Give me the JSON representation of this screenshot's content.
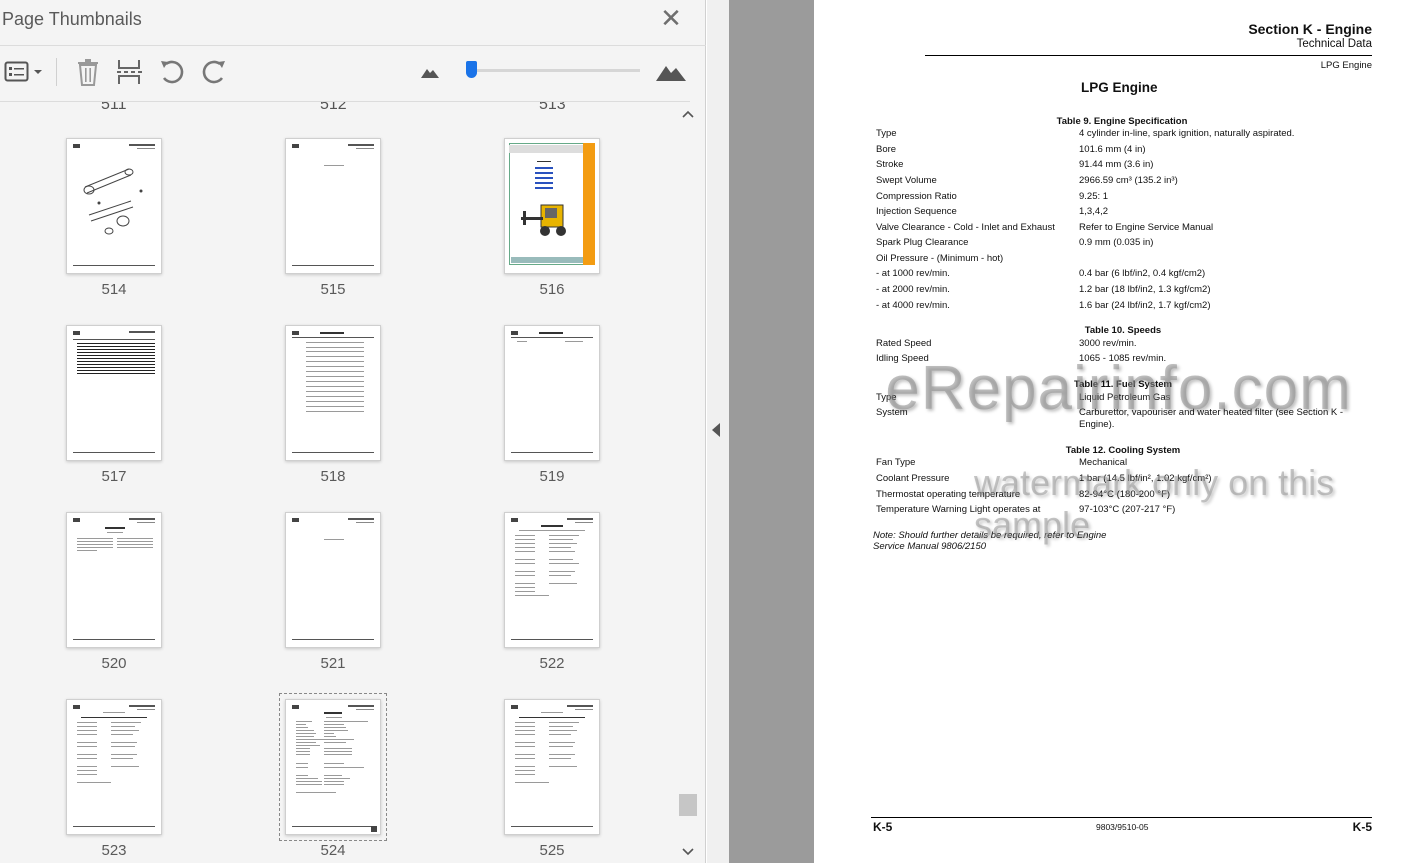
{
  "panel": {
    "title": "Page Thumbnails",
    "close_glyph": "✕",
    "toolbar": {
      "options_icon": "list-options-icon",
      "delete_icon": "trash-icon",
      "extract_icon": "extract-pages-icon",
      "undo_icon": "rotate-ccw-icon",
      "redo_icon": "rotate-cw-icon",
      "zoom_out_icon": "small-mountain-icon",
      "zoom_in_icon": "large-mountain-icon",
      "zoom_level": 0.02
    },
    "cut_labels": [
      "511",
      "512",
      "513"
    ],
    "thumbnails": [
      {
        "label": "514",
        "selected": false
      },
      {
        "label": "515",
        "selected": false
      },
      {
        "label": "516",
        "selected": false
      },
      {
        "label": "517",
        "selected": false
      },
      {
        "label": "518",
        "selected": false
      },
      {
        "label": "519",
        "selected": false
      },
      {
        "label": "520",
        "selected": false
      },
      {
        "label": "521",
        "selected": false
      },
      {
        "label": "522",
        "selected": false
      },
      {
        "label": "523",
        "selected": false
      },
      {
        "label": "524",
        "selected": true
      },
      {
        "label": "525",
        "selected": false
      }
    ]
  },
  "document": {
    "header_section": "Section K - Engine",
    "header_sub": "Technical Data",
    "header_topic": "LPG Engine",
    "page_title": "LPG Engine",
    "tables": [
      {
        "title": "Table 9. Engine Specification",
        "rows": [
          {
            "label": "Type",
            "value": "4 cylinder in-line, spark ignition, naturally aspirated."
          },
          {
            "label": "Bore",
            "value": "101.6 mm (4 in)"
          },
          {
            "label": "Stroke",
            "value": "91.44 mm (3.6 in)"
          },
          {
            "label": "Swept Volume",
            "value": "2966.59 cm³ (135.2 in³)"
          },
          {
            "label": "Compression Ratio",
            "value": "9.25: 1"
          },
          {
            "label": "Injection Sequence",
            "value": "1,3,4,2"
          },
          {
            "label": "Valve Clearance - Cold - Inlet and Exhaust",
            "value": "Refer to Engine Service Manual"
          },
          {
            "label": "Spark Plug Clearance",
            "value": "0.9 mm (0.035 in)"
          },
          {
            "label": "Oil Pressure - (Minimum - hot)",
            "value": ""
          },
          {
            "label": "- at 1000 rev/min.",
            "value": "0.4 bar (6 lbf/in2, 0.4 kgf/cm2)"
          },
          {
            "label": "- at 2000 rev/min.",
            "value": "1.2 bar (18 lbf/in2, 1.3 kgf/cm2)"
          },
          {
            "label": "- at 4000 rev/min.",
            "value": "1.6 bar (24 lbf/in2, 1.7 kgf/cm2)"
          }
        ]
      },
      {
        "title": "Table 10. Speeds",
        "rows": [
          {
            "label": "Rated Speed",
            "value": "3000 rev/min."
          },
          {
            "label": "Idling Speed",
            "value": "1065 - 1085 rev/min."
          }
        ]
      },
      {
        "title": "Table 11. Fuel System",
        "rows": [
          {
            "label": "Type",
            "value": "Liquid Petroleum Gas"
          },
          {
            "label": "System",
            "value": "Carburettor, vapouriser and water heated filter (see Section K - Engine)."
          }
        ]
      },
      {
        "title": "Table 12. Cooling System",
        "rows": [
          {
            "label": "Fan Type",
            "value": "Mechanical"
          },
          {
            "label": "Coolant Pressure",
            "value": "1 bar (14.5 lbf/in², 1.02 kgf/cm²)"
          },
          {
            "label": "Thermostat operating temperature",
            "value": "82-94°C (180-200 °F)"
          },
          {
            "label": "Temperature Warning Light operates at",
            "value": "97-103°C (207-217 °F)"
          }
        ]
      }
    ],
    "note_line1": "Note: Should further details be required, refer to Engine",
    "note_line2": "Service Manual 9806/2150",
    "footer_left": "K-5",
    "footer_center": "9803/9510-05",
    "footer_right": "K-5",
    "watermark_main": "eRepairinfo.com",
    "watermark_sub": "watermark only on this sample"
  },
  "colors": {
    "accent": "#1a73e8",
    "panel_bg": "#f4f4f4",
    "gutter": "#9b9b9b",
    "thumb_orange": "#f39c12"
  }
}
